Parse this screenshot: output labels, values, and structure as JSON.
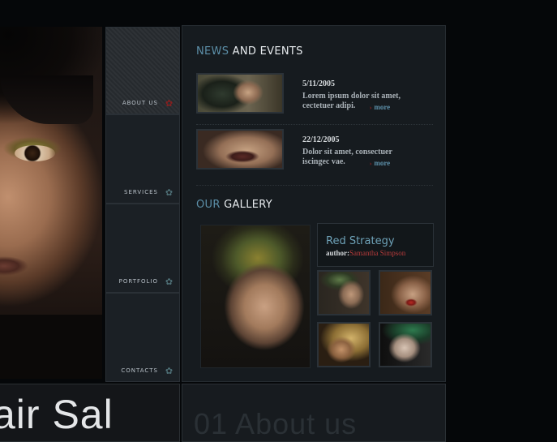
{
  "nav": {
    "items": [
      {
        "label": "ABOUT US",
        "icon": "flower-icon",
        "active": true
      },
      {
        "label": "SERVICES",
        "icon": "flower-icon",
        "active": false
      },
      {
        "label": "PORTFOLIO",
        "icon": "flower-icon",
        "active": false
      },
      {
        "label": "CONTACTS",
        "icon": "flower-icon",
        "active": false
      }
    ]
  },
  "news": {
    "title_highlight": "NEWS",
    "title_rest": " AND EVENTS",
    "items": [
      {
        "date": "5/11/2005",
        "text": "Lorem ipsum dolor sit amet, cectetuer adipi.",
        "more": "more"
      },
      {
        "date": "22/12/2005",
        "text": "Dolor sit amet, consectuer iscingec vae.",
        "more": "more"
      }
    ]
  },
  "gallery": {
    "title_highlight": "OUR",
    "title_rest": " GALLERY",
    "feature_title": "Red Strategy",
    "author_label": "author:",
    "author_name": "Samantha Simpson"
  },
  "bottom": {
    "left_text": "air Sal",
    "right_text": "01   About us"
  },
  "colors": {
    "accent_blue": "#5c8fa8",
    "accent_red": "#b02525",
    "background": "#050709",
    "panel": "#161b1f"
  }
}
